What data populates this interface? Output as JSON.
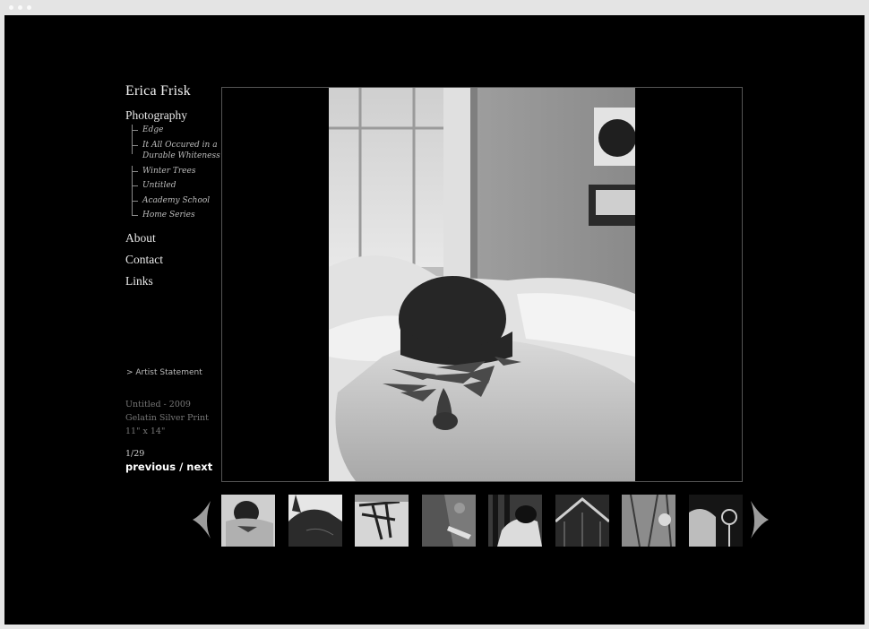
{
  "site": {
    "title": "Erica Frisk"
  },
  "nav": {
    "photography": "Photography",
    "series": [
      "Edge",
      "It All Occured in a",
      "Durable Whiteness",
      "Winter Trees",
      "Untitled",
      "Academy School",
      "Home Series"
    ],
    "about": "About",
    "contact": "Contact",
    "links": "Links"
  },
  "artist_statement": "> Artist Statement",
  "caption": {
    "title": "Untitled - 2009",
    "medium": "Gelatin Silver Print",
    "size": "11\" x 14\""
  },
  "counter": "1/29",
  "pager": {
    "previous": "previous",
    "separator": " / ",
    "next": "next"
  },
  "icons": {
    "prev": "chevron-left-icon",
    "next": "chevron-right-icon"
  },
  "colors": {
    "background": "#000000",
    "text": "#e8e8e8",
    "muted": "#777777"
  },
  "thumbnails": [
    "thumbnail-1",
    "thumbnail-2",
    "thumbnail-3",
    "thumbnail-4",
    "thumbnail-5",
    "thumbnail-6",
    "thumbnail-7",
    "thumbnail-8"
  ]
}
